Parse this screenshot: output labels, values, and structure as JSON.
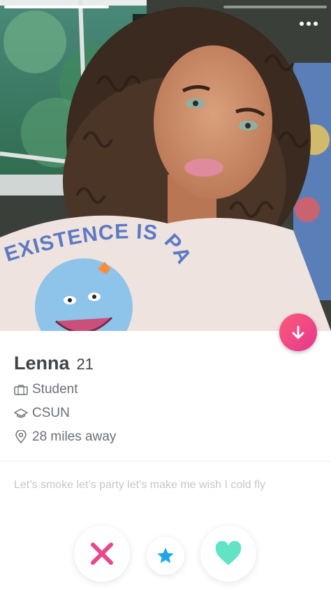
{
  "profile": {
    "name": "Lenna",
    "age": "21",
    "job": "Student",
    "school": "CSUN",
    "distance": "28 miles away",
    "bio": "Let’s smoke let’s party let’s make me wish I cold fly"
  },
  "shirt": {
    "print_text": "EXISTENCE IS PA"
  },
  "photo": {
    "photo_index": 1,
    "photo_count": 2
  },
  "icons": {
    "more": "more-dots-icon",
    "info": "arrow-down-icon",
    "job": "briefcase-icon",
    "school": "graduation-cap-icon",
    "distance": "location-pin-icon",
    "nope": "x-icon",
    "super_like": "star-icon",
    "like": "heart-icon"
  },
  "colors": {
    "brand_pink": "#fd5a7a",
    "nope_pink": "#e8478e",
    "super_like_blue": "#1ea6e6",
    "like_green": "#62e3c4",
    "text_dark": "#3f4449",
    "text_gray": "#6a7178",
    "bio_gray": "#c3c7cb"
  }
}
